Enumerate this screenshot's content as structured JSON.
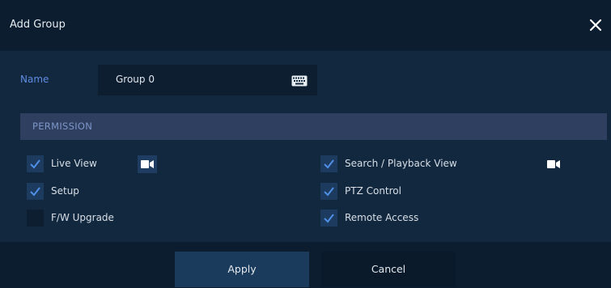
{
  "dialog": {
    "title": "Add Group",
    "close_icon": "close-icon"
  },
  "name_field": {
    "label": "Name",
    "value": "Group 0",
    "keyboard_icon": "keyboard-icon"
  },
  "permission": {
    "header": "PERMISSION",
    "items": [
      {
        "label": "Live View",
        "checked": true
      },
      {
        "label": "Setup",
        "checked": true
      },
      {
        "label": "F/W Upgrade",
        "checked": false
      },
      {
        "label": "Search / Playback View",
        "checked": true
      },
      {
        "label": "PTZ Control",
        "checked": true
      },
      {
        "label": "Remote Access",
        "checked": true
      }
    ]
  },
  "buttons": {
    "apply": "Apply",
    "cancel": "Cancel"
  },
  "colors": {
    "background": "#12283f",
    "titlebar": "#0b1d2f",
    "accent_label": "#5f8ce0",
    "checkbox": "#1d3a5f",
    "checkmark": "#4f8fe6"
  }
}
